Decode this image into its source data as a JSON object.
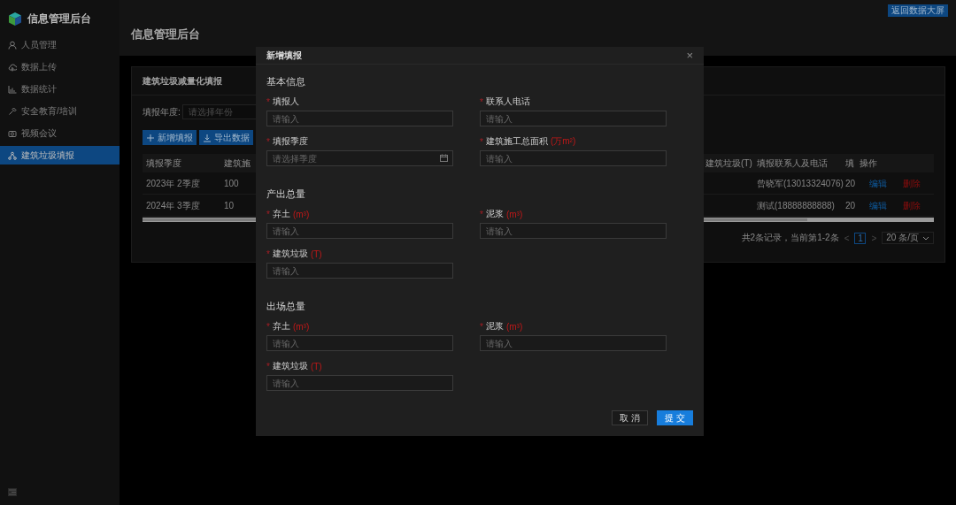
{
  "sidebar": {
    "logo_title": "信息管理后台",
    "items": [
      {
        "label": "人员管理",
        "selected": false
      },
      {
        "label": "数据上传",
        "selected": false
      },
      {
        "label": "数据统计",
        "selected": false
      },
      {
        "label": "安全教育/培训",
        "selected": false
      },
      {
        "label": "视频会议",
        "selected": false
      },
      {
        "label": "建筑垃圾填报",
        "selected": true
      }
    ]
  },
  "header": {
    "back_button": "返回数据大屏",
    "page_title": "信息管理后台"
  },
  "card": {
    "title": "建筑垃圾减量化填报",
    "filter": {
      "label": "填报年度:",
      "placeholder": "请选择年份"
    },
    "buttons": [
      {
        "label": "新增填报"
      },
      {
        "label": "导出数据"
      }
    ],
    "table": {
      "columns": [
        "填报季度",
        "建筑施",
        "建筑垃圾(T)",
        "填报联系人及电话",
        "填",
        "操作"
      ],
      "rows": [
        {
          "cells": [
            "2023年 2季度",
            "100",
            "",
            "曾晓军(13013324076)",
            "20"
          ],
          "actions": [
            {
              "label": "编辑",
              "kind": "edit"
            },
            {
              "label": "删除",
              "kind": "delete"
            }
          ]
        },
        {
          "cells": [
            "2024年 3季度",
            "10",
            "",
            "测试(18888888888)",
            "20"
          ],
          "actions": [
            {
              "label": "编辑",
              "kind": "edit"
            },
            {
              "label": "删除",
              "kind": "delete"
            }
          ]
        }
      ]
    },
    "pagination": {
      "summary": "共2条记录，当前第1-2条",
      "prev": "<",
      "pages": [
        {
          "label": "1",
          "selected": true
        }
      ],
      "next": ">",
      "page_size": "20 条/页"
    }
  },
  "modal": {
    "title": "新增填报",
    "close": "×",
    "sections": [
      {
        "title": "基本信息",
        "fields": [
          {
            "label": "填报人",
            "required_mark": "*",
            "placeholder": "请输入",
            "kind": "text"
          },
          {
            "label": "联系人电话",
            "required_mark": "*",
            "placeholder": "请输入",
            "kind": "text"
          },
          {
            "label": "填报季度",
            "required_mark": "*",
            "placeholder": "请选择季度",
            "kind": "date"
          },
          {
            "label": "建筑施工总面积",
            "unit": "(万m²)",
            "required_mark": "*",
            "placeholder": "请输入",
            "kind": "text"
          }
        ]
      },
      {
        "title": "产出总量",
        "fields": [
          {
            "label": "弃土",
            "unit": "(m³)",
            "required_mark": "*",
            "placeholder": "请输入",
            "kind": "text"
          },
          {
            "label": "泥浆",
            "unit": "(m³)",
            "required_mark": "*",
            "placeholder": "请输入",
            "kind": "text"
          },
          {
            "label": "建筑垃圾",
            "unit": "(T)",
            "required_mark": "*",
            "placeholder": "请输入",
            "kind": "text"
          }
        ]
      },
      {
        "title": "出场总量",
        "fields": [
          {
            "label": "弃土",
            "unit": "(m³)",
            "required_mark": "*",
            "placeholder": "请输入",
            "kind": "text"
          },
          {
            "label": "泥浆",
            "unit": "(m³)",
            "required_mark": "*",
            "placeholder": "请输入",
            "kind": "text"
          },
          {
            "label": "建筑垃圾",
            "unit": "(T)",
            "required_mark": "*",
            "placeholder": "请输入",
            "kind": "text"
          }
        ]
      }
    ],
    "buttons": [
      {
        "label": "取 消",
        "kind": "cancel"
      },
      {
        "label": "提 交",
        "kind": "submit"
      }
    ]
  }
}
